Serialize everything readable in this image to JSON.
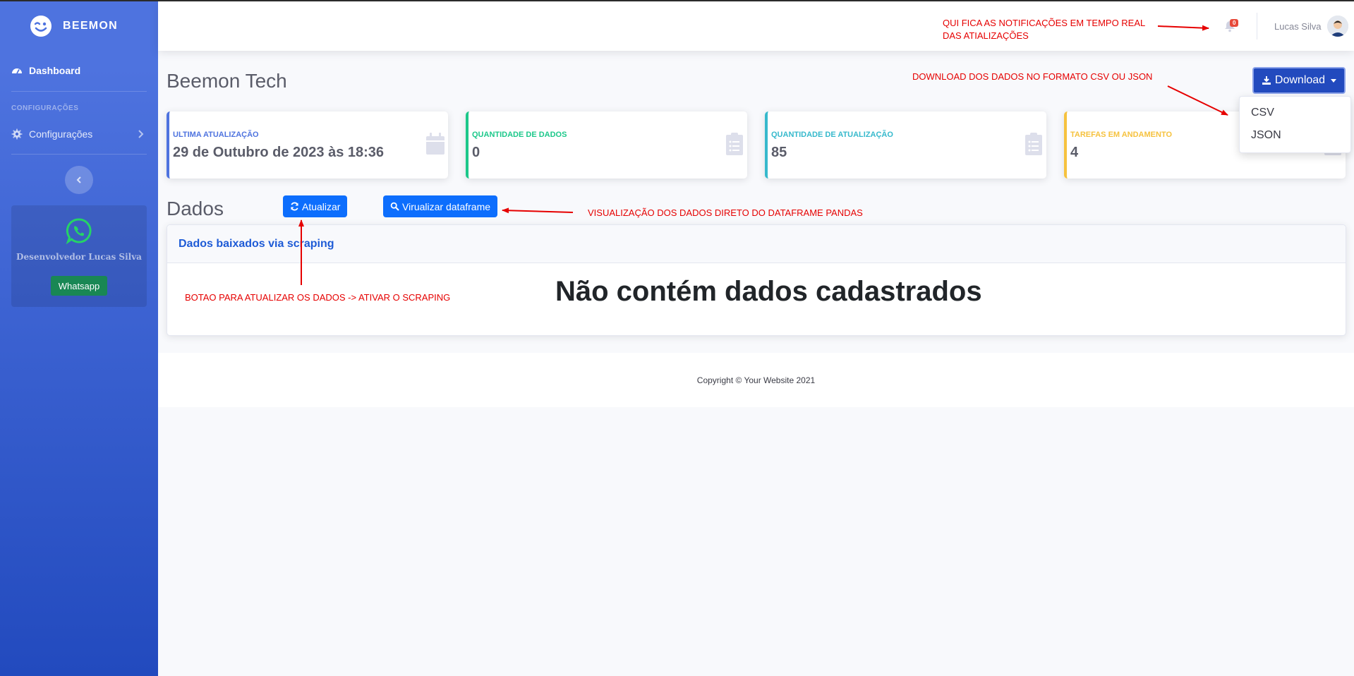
{
  "sidebar": {
    "brand": "BEEMON",
    "nav_dashboard": "Dashboard",
    "heading": "CONFIGURAÇÕES",
    "nav_config": "Configurações",
    "dev_name": "Desenvolvedor Lucas Silva",
    "whatsapp_button": "Whatsapp"
  },
  "topbar": {
    "notification_count": "0",
    "user_name": "Lucas Silva"
  },
  "page": {
    "title": "Beemon Tech",
    "download_label": "Download",
    "download_options": [
      "CSV",
      "JSON"
    ]
  },
  "stats": [
    {
      "label": "ULTIMA ATUALIZAÇÃO",
      "value": "29 de Outubro de 2023 às 18:36",
      "color": "#4e73df"
    },
    {
      "label": "QUANTIDADE DE DADOS",
      "value": "0",
      "color": "#1cc88a"
    },
    {
      "label": "QUANTIDADE DE ATUALIZAÇÃO",
      "value": "85",
      "color": "#36b9cc"
    },
    {
      "label": "TAREFAS EM ANDAMENTO",
      "value": "4",
      "color": "#f6c23e"
    }
  ],
  "data_section": {
    "title": "Dados",
    "refresh_button": "Atualizar",
    "view_button": "Virualizar dataframe",
    "panel_title": "Dados baixados via scraping",
    "empty_message": "Não contém dados cadastrados"
  },
  "footer": {
    "copyright": "Copyright © Your Website 2021"
  },
  "annotations": {
    "notifications_line1": "QUI FICA AS NOTIFICAÇÕES EM TEMPO REAL",
    "notifications_line2": "DAS ATIALIZAÇÕES",
    "download": "DOWNLOAD DOS DADOS NO FORMATO CSV OU JSON",
    "dataframe": "VISUALIZAÇÃO DOS DADOS DIRETO DO DATAFRAME PANDAS",
    "refresh": "BOTAO PARA ATUALIZAR OS DADOS -> ATIVAR O SCRAPING"
  }
}
